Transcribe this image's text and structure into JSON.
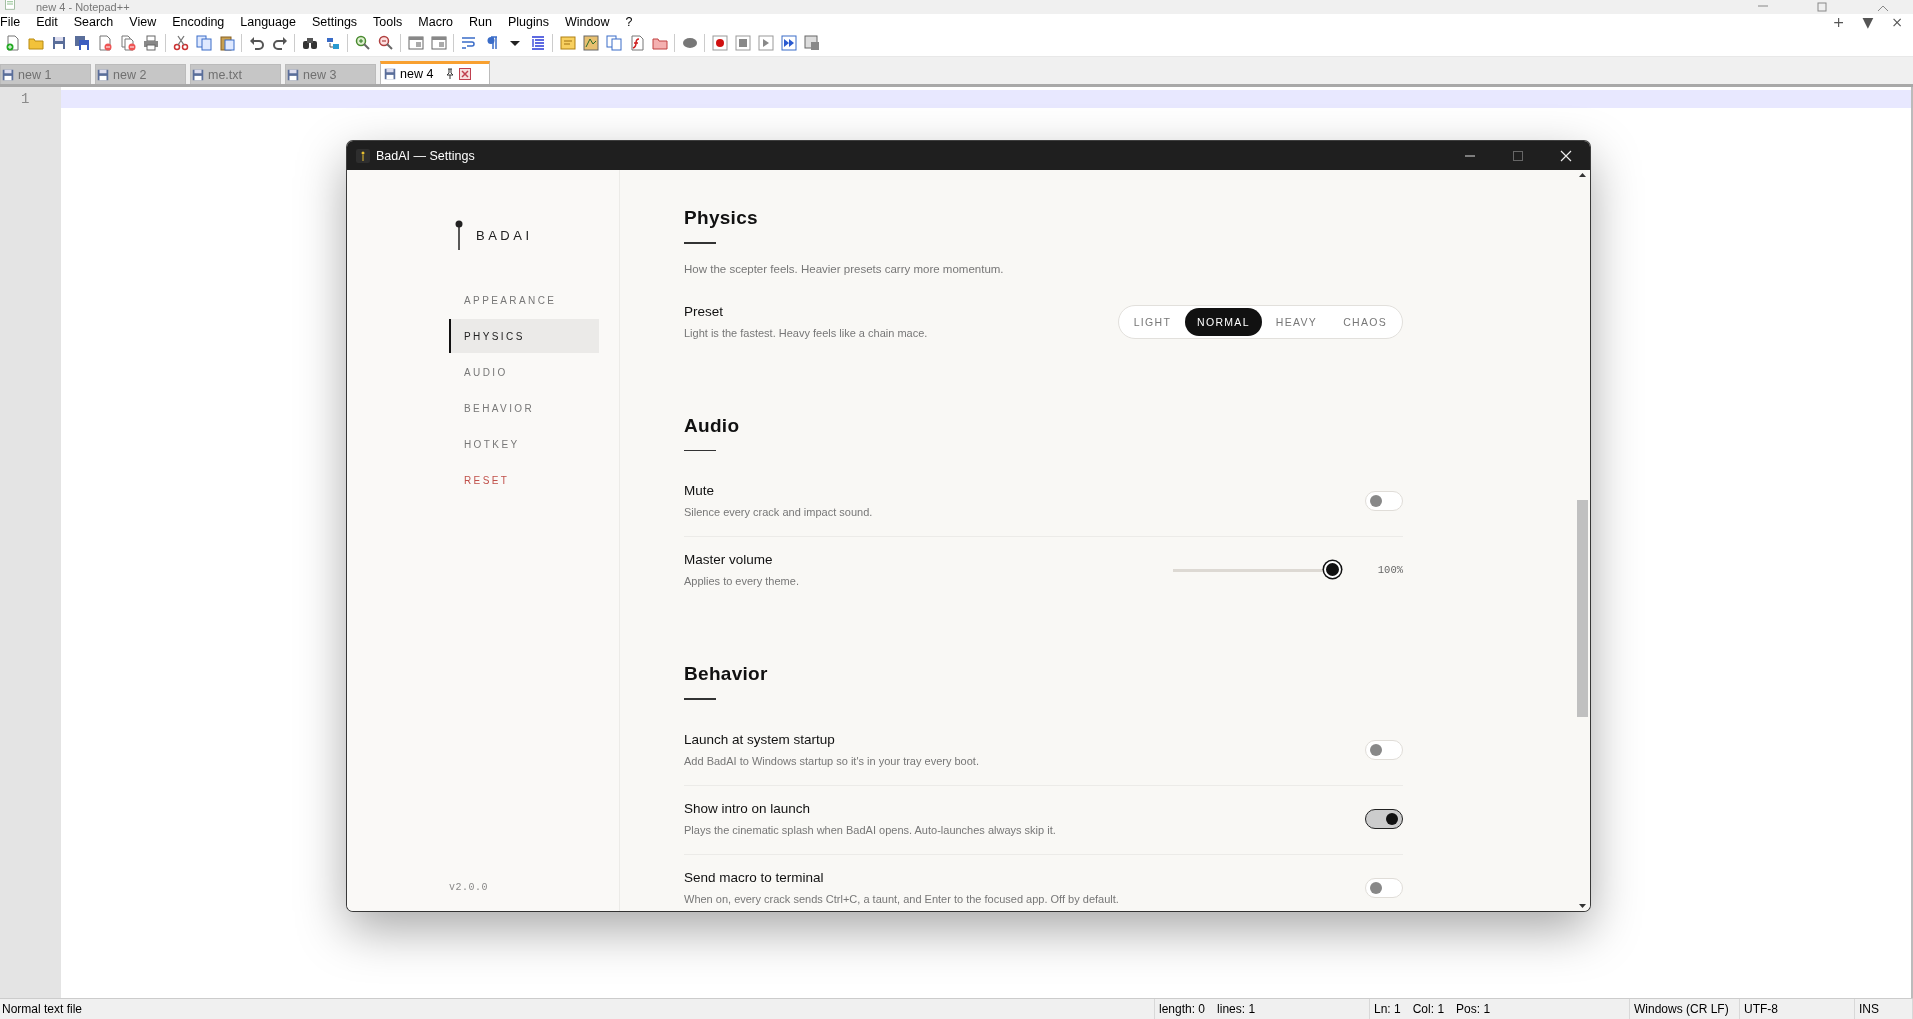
{
  "app": {
    "title": "new 4 - Notepad++",
    "menu": [
      "File",
      "Edit",
      "Search",
      "View",
      "Encoding",
      "Language",
      "Settings",
      "Tools",
      "Macro",
      "Run",
      "Plugins",
      "Window",
      "?"
    ],
    "tab_controls": [
      "+",
      "▼",
      "×"
    ]
  },
  "tabs": [
    {
      "label": "new 1",
      "selected": false
    },
    {
      "label": "new 2",
      "selected": false
    },
    {
      "label": "me.txt",
      "selected": false
    },
    {
      "label": "new 3",
      "selected": false
    },
    {
      "label": "new 4",
      "selected": true
    }
  ],
  "editor": {
    "line_numbers": [
      "1"
    ]
  },
  "dialog": {
    "title": "BadAI — Settings",
    "brand": "BADAI",
    "nav": [
      {
        "label": "APPEARANCE",
        "selected": false,
        "kind": "normal"
      },
      {
        "label": "PHYSICS",
        "selected": true,
        "kind": "normal"
      },
      {
        "label": "AUDIO",
        "selected": false,
        "kind": "normal"
      },
      {
        "label": "BEHAVIOR",
        "selected": false,
        "kind": "normal"
      },
      {
        "label": "HOTKEY",
        "selected": false,
        "kind": "normal"
      },
      {
        "label": "RESET",
        "selected": false,
        "kind": "danger"
      }
    ],
    "version": "v2.0.0",
    "sections": [
      {
        "title": "Physics",
        "description": "How the scepter feels. Heavier presets carry more momentum.",
        "settings": [
          {
            "kind": "segmented",
            "label": "Preset",
            "hint": "Light is the fastest. Heavy feels like a chain mace.",
            "options": [
              {
                "label": "LIGHT",
                "selected": false
              },
              {
                "label": "NORMAL",
                "selected": true
              },
              {
                "label": "HEAVY",
                "selected": false
              },
              {
                "label": "CHAOS",
                "selected": false
              }
            ]
          }
        ]
      },
      {
        "title": "Audio",
        "settings": [
          {
            "kind": "toggle",
            "label": "Mute",
            "hint": "Silence every crack and impact sound.",
            "on": false
          },
          {
            "kind": "slider",
            "label": "Master volume",
            "hint": "Applies to every theme.",
            "level": 1,
            "reading": "100%"
          }
        ]
      },
      {
        "title": "Behavior",
        "settings": [
          {
            "kind": "toggle",
            "label": "Launch at system startup",
            "hint": "Add BadAI to Windows startup so it's in your tray every boot.",
            "on": false
          },
          {
            "kind": "toggle",
            "label": "Show intro on launch",
            "hint": "Plays the cinematic splash when BadAI opens. Auto-launches always skip it.",
            "on": true
          },
          {
            "kind": "toggle",
            "label": "Send macro to terminal",
            "hint": "When on, every crack sends Ctrl+C, a taunt, and Enter to the focused app. Off by default.",
            "on": false
          }
        ]
      }
    ]
  },
  "status_bar": [
    {
      "texts": [
        "Normal text file"
      ]
    },
    {
      "texts": [
        "length: 0",
        "lines: 1"
      ]
    },
    {
      "texts": [
        "Ln: 1",
        "Col: 1",
        "Pos: 1"
      ]
    },
    {
      "texts": [
        "Windows (CR LF)"
      ]
    },
    {
      "texts": [
        "UTF-8"
      ]
    },
    {
      "texts": [
        "INS"
      ]
    }
  ]
}
